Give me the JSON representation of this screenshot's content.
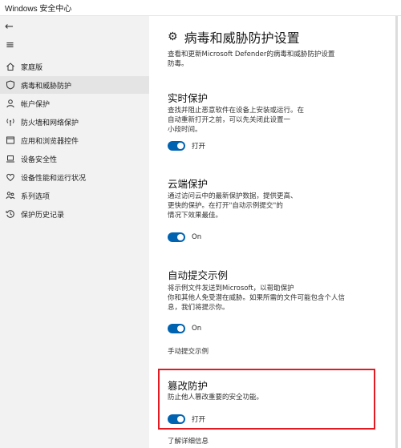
{
  "window": {
    "title": "Windows 安全中心"
  },
  "sidebar": {
    "items": [
      {
        "icon": "home-icon",
        "label": "家庭版",
        "active": false
      },
      {
        "icon": "shield-icon",
        "label": "病毒和威胁防护",
        "active": true
      },
      {
        "icon": "person-icon",
        "label": "帐户保护",
        "active": false
      },
      {
        "icon": "antenna-icon",
        "label": "防火墙和网络保护",
        "active": false
      },
      {
        "icon": "window-icon",
        "label": "应用和浏览器控件",
        "active": false
      },
      {
        "icon": "laptop-icon",
        "label": "设备安全性",
        "active": false
      },
      {
        "icon": "heart-icon",
        "label": "设备性能和运行状况",
        "active": false
      },
      {
        "icon": "family-icon",
        "label": "系列选项",
        "active": false
      },
      {
        "icon": "history-icon",
        "label": "保护历史记录",
        "active": false
      }
    ]
  },
  "main": {
    "title": "病毒和威胁防护设置",
    "description_line1": "查看和更新Microsoft Defender的病毒和威胁防护设置",
    "description_line2": "防毒。",
    "sections": {
      "realtime": {
        "title": "实时保护",
        "desc1": "查找并阻止恶意软件在设备上安装或运行。在",
        "desc2": "自动重新打开之前，可以先关闭此设置一",
        "desc3": "小段时间。",
        "toggle_label": "打开"
      },
      "cloud": {
        "title": "云端保护",
        "desc1": "通过访问云中的最新保护数据，提供更高、",
        "desc2": "更快的保护。在打开\"自动示例提交\"的",
        "desc3": "情况下效果最佳。",
        "toggle_label": "On"
      },
      "sample": {
        "title": "自动提交示例",
        "desc1": "将示例文件发送到Microsoft，以帮助保护",
        "desc2": "你和其他人免受潜在威胁。如果所需的文件可能包含个人信",
        "desc3": "息，我们将提示你。",
        "toggle_label": "On",
        "link": "手动提交示例"
      },
      "tamper": {
        "title": "篡改防护",
        "desc1": "防止他人篡改重要的安全功能。",
        "toggle_label": "打开",
        "link": "了解详细信息"
      }
    }
  },
  "colors": {
    "accent": "#0063b1",
    "highlight": "#e21b23",
    "sidebar_bg": "#f2f2f2"
  }
}
